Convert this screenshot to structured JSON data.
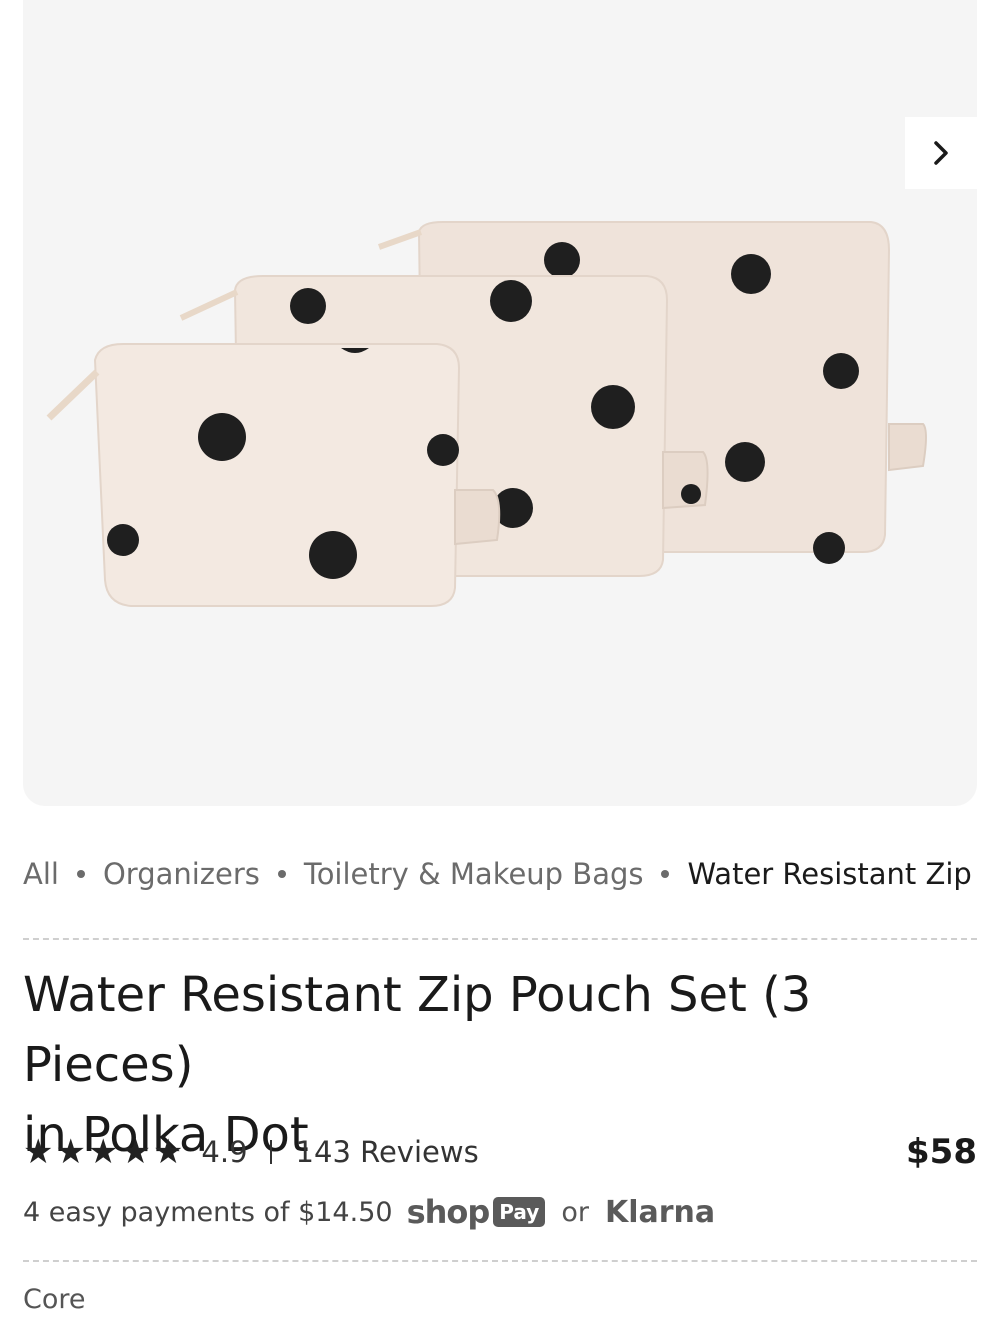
{
  "gallery": {
    "image_alt": "Three beige zip pouches with black polka dots",
    "next_icon": "chevron-right-icon",
    "colors": {
      "background": "#f5f5f5",
      "pouch": "#efe3da",
      "dot": "#1f1f1f"
    }
  },
  "breadcrumb": {
    "items": [
      "All",
      "Organizers",
      "Toiletry & Makeup Bags",
      "Water Resistant Zip Pouch"
    ]
  },
  "product": {
    "title_line1": "Water Resistant Zip Pouch Set (3 Pieces)",
    "title_line2": "in Polka Dot",
    "rating": "4.9",
    "rating_stars": 5,
    "reviews": "143 Reviews",
    "price": "$58"
  },
  "payments": {
    "text": "4 easy payments of $14.50",
    "shop_label": "shop",
    "pay_label": "Pay",
    "or_label": "or",
    "klarna_label": "Klarna"
  },
  "collection": {
    "label": "Core"
  }
}
